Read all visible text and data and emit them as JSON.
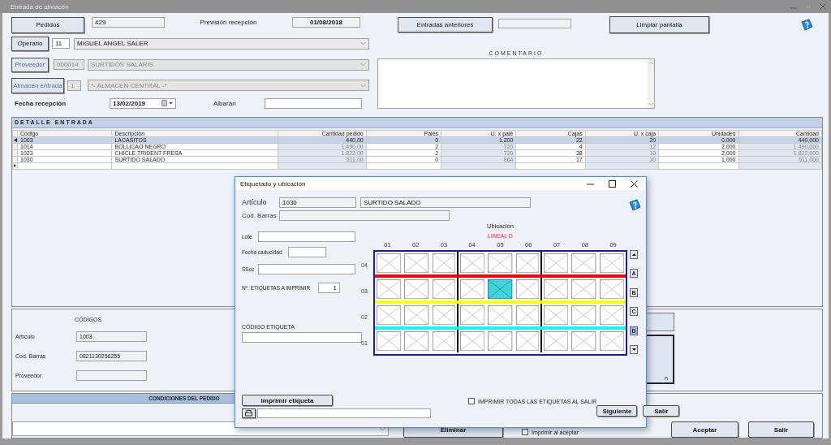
{
  "window": {
    "title": "Entrada de almacén"
  },
  "header": {
    "pedidos_button": "Pedidos",
    "pedido": "429",
    "prevision_label": "Previsión recepción",
    "prevision": "01/08/2018",
    "entradas_button": "Entradas anteriores",
    "limpiar_button": "Limpiar pantalla"
  },
  "parties": [
    {
      "button": "Operario",
      "code": "11",
      "name": "MIGUEL ANGEL SALER",
      "disabled": false
    },
    {
      "button": "Proveedor",
      "code": "000014",
      "name": "SURTIDOS SALARIS",
      "disabled": true
    },
    {
      "button": "Almacén entrada",
      "code": "1",
      "name": "*- ALMACEN CENTRAL -*",
      "disabled": true
    }
  ],
  "fecha": {
    "label": "Fecha recepción",
    "value": "13/02/2019"
  },
  "albaran": {
    "label": "Albarán"
  },
  "comentario": {
    "label": "COMENTARIO"
  },
  "detalle": {
    "title": "DETALLE ENTRADA",
    "columns": [
      {
        "label": "Código",
        "kind": "text"
      },
      {
        "label": "Descripción",
        "kind": "text"
      },
      {
        "label": "Cantidad pedido",
        "kind": "computed"
      },
      {
        "label": "Palés",
        "kind": "number"
      },
      {
        "label": "U. x palé",
        "kind": "computed"
      },
      {
        "label": "Cajas",
        "kind": "number"
      },
      {
        "label": "U. x caja",
        "kind": "computed"
      },
      {
        "label": "Unidades",
        "kind": "number"
      },
      {
        "label": "Cantidad",
        "kind": "computed"
      }
    ],
    "rows": [
      {
        "selected": true,
        "cells": [
          "1003",
          "LACASITOS",
          "440,00",
          "0",
          "1.200",
          "22",
          "20",
          "0,000",
          "440,000"
        ]
      },
      {
        "selected": false,
        "cells": [
          "1014",
          "BOLLICAO NEGRO",
          "1.490,00",
          "2",
          "720",
          "4",
          "12",
          "2,000",
          "1.490,000"
        ]
      },
      {
        "selected": false,
        "cells": [
          "1023",
          "CHICLE TRIDENT FRESA",
          "1.822,00",
          "2",
          "720",
          "38",
          "10",
          "2,000",
          "1.822,000"
        ]
      },
      {
        "selected": false,
        "cells": [
          "1030",
          "SURTIDO SALADO",
          "511,00",
          "0",
          "864",
          "17",
          "30",
          "1,000",
          "511,000"
        ]
      }
    ]
  },
  "codigos": {
    "title": "CÓDIGOS",
    "fields": [
      {
        "label": "Artículo",
        "value": "1003"
      },
      {
        "label": "Cod. Barras",
        "value": "0821130256255"
      },
      {
        "label": "Proveedor"
      }
    ]
  },
  "side_panel": {
    "text": "n"
  },
  "condiciones": {
    "title": "CONDICIONES DEL PEDIDO"
  },
  "footer": {
    "eliminar": "Eliminar",
    "imprimir": {
      "label": "Imprimir al aceptar",
      "checked": false
    },
    "aceptar": "Aceptar",
    "salir": "Salir"
  },
  "dialog": {
    "title": "Etiquetado y ubicación",
    "articulo": {
      "label": "Artículo",
      "code": "1030",
      "name": "SURTIDO SALADO"
    },
    "barras": {
      "label": "Cod. Barras"
    },
    "fields": [
      {
        "label": "Lote"
      },
      {
        "label": "Fecha caducidad"
      },
      {
        "label": "SScc"
      },
      {
        "label": "Nº. ETIQUETAS A IMPRIMIR",
        "value": "1"
      }
    ],
    "codigo": {
      "label": "CÓDIGO ETIQUETA"
    },
    "ubicacion": {
      "title": "Ubicación",
      "lineal": "LINEAL  D",
      "columns": [
        "01",
        "02",
        "03",
        "04",
        "05",
        "06",
        "07",
        "08",
        "09"
      ],
      "levels": [
        {
          "label": "04",
          "color": "#ff0000",
          "cells": [
            {
              "selected": false
            },
            {
              "selected": false
            },
            {
              "selected": false
            },
            {
              "selected": false
            },
            {
              "selected": false
            },
            {
              "selected": false
            },
            {
              "selected": false
            },
            {
              "selected": false
            },
            {
              "selected": false
            }
          ]
        },
        {
          "label": "03",
          "color": "#ffff00",
          "cells": [
            {
              "selected": false
            },
            {
              "selected": false
            },
            {
              "selected": false
            },
            {
              "selected": false
            },
            {
              "selected": true
            },
            {
              "selected": false
            },
            {
              "selected": false
            },
            {
              "selected": false
            },
            {
              "selected": false
            }
          ]
        },
        {
          "label": "02",
          "color": "#00ffff",
          "cells": [
            {
              "selected": false
            },
            {
              "selected": false
            },
            {
              "selected": false
            },
            {
              "selected": false
            },
            {
              "selected": false
            },
            {
              "selected": false
            },
            {
              "selected": false
            },
            {
              "selected": false
            },
            {
              "selected": false
            }
          ]
        },
        {
          "label": "01",
          "cells": [
            {
              "selected": false
            },
            {
              "selected": false
            },
            {
              "selected": false
            },
            {
              "selected": false
            },
            {
              "selected": false
            },
            {
              "selected": false
            },
            {
              "selected": false
            },
            {
              "selected": false
            },
            {
              "selected": false
            }
          ]
        }
      ],
      "sections": [
        {
          "label": "A",
          "selected": false
        },
        {
          "label": "B",
          "selected": false
        },
        {
          "label": "C",
          "selected": false
        },
        {
          "label": "D",
          "selected": true
        }
      ]
    },
    "print_button": "Imprimir etiqueta",
    "print_all": {
      "label": "IMPRIMIR TODAS LAS ETIQUETAS AL SALIR",
      "checked": false
    },
    "next_button": "Siguiente",
    "exit_button": "Salir"
  }
}
